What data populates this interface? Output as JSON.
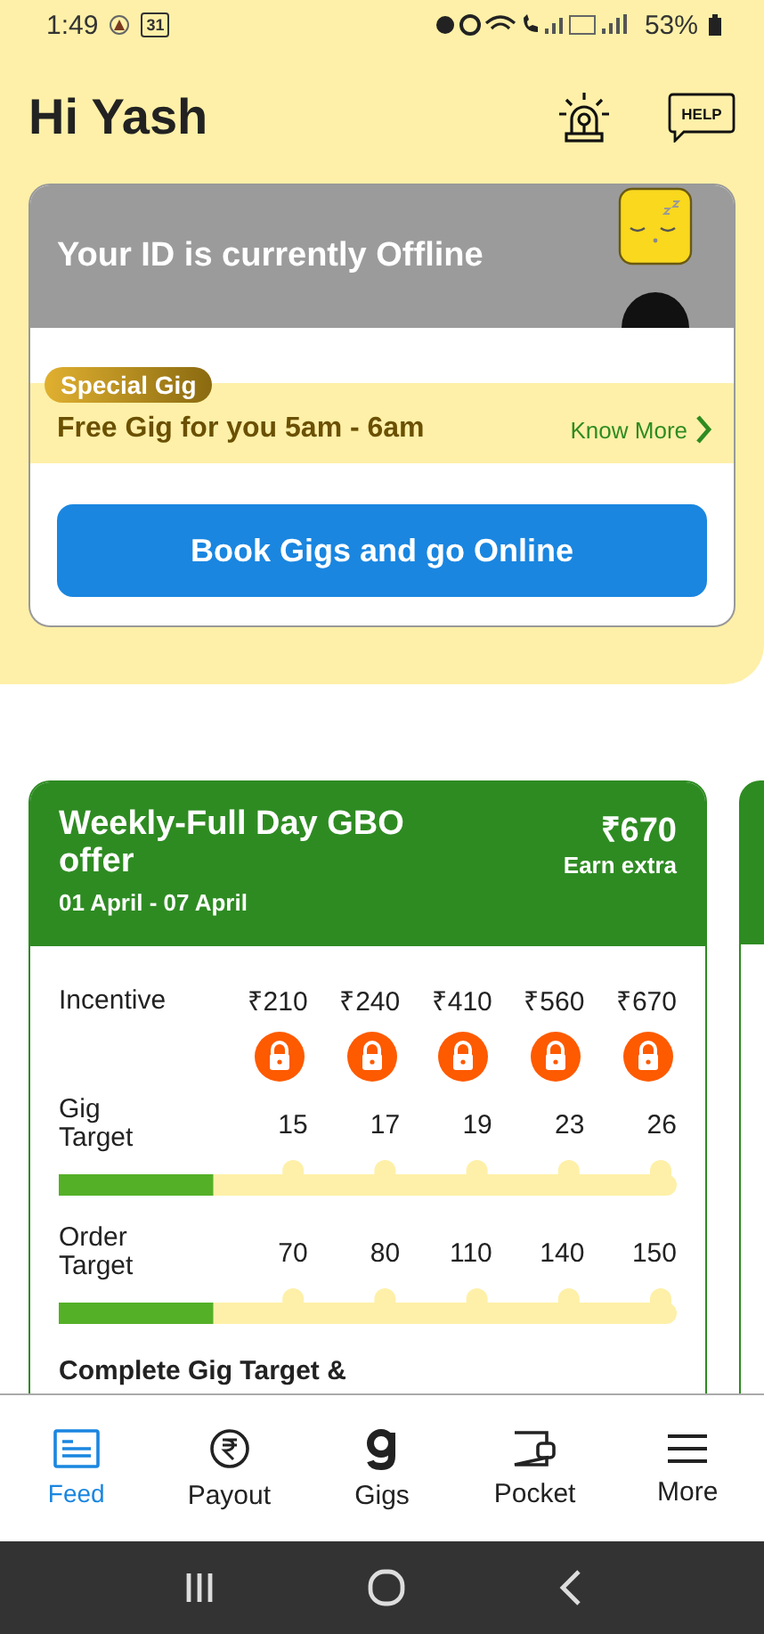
{
  "status_bar": {
    "time": "1:49",
    "calendar_date": "31",
    "battery": "53%"
  },
  "header": {
    "greeting": "Hi Yash",
    "help": "HELP"
  },
  "status_card": {
    "title": "Your ID is currently Offline",
    "special": {
      "badge": "Special Gig",
      "text": "Free Gig for you 5am - 6am",
      "link": "Know More"
    },
    "button": "Book Gigs and go Online"
  },
  "offer": {
    "title": "Weekly-Full Day GBO offer",
    "dates": "01 April - 07 April",
    "amount": "₹670",
    "amount_label": "Earn extra",
    "incentive_label": "Incentive",
    "gig_label": "Gig Target",
    "order_label": "Order Target",
    "tiers": [
      {
        "incentive": "₹210",
        "locked": true,
        "gig_target": "15",
        "order_target": "70"
      },
      {
        "incentive": "₹240",
        "locked": true,
        "gig_target": "17",
        "order_target": "80"
      },
      {
        "incentive": "₹410",
        "locked": true,
        "gig_target": "19",
        "order_target": "110"
      },
      {
        "incentive": "₹560",
        "locked": true,
        "gig_target": "23",
        "order_target": "140"
      },
      {
        "incentive": "₹670",
        "locked": true,
        "gig_target": "26",
        "order_target": "150"
      }
    ],
    "gig_progress": {
      "level": 0.25
    },
    "order_progress": {
      "level": 0.25
    },
    "footer": "Complete Gig Target &"
  },
  "nav": [
    {
      "kind": "feed",
      "label": "Feed",
      "selected": true
    },
    {
      "kind": "payout",
      "label": "Payout",
      "selected": false
    },
    {
      "kind": "gigs",
      "label": "Gigs",
      "selected": false
    },
    {
      "kind": "pocket",
      "label": "Pocket",
      "selected": false
    },
    {
      "kind": "more",
      "label": "More",
      "selected": false
    }
  ]
}
